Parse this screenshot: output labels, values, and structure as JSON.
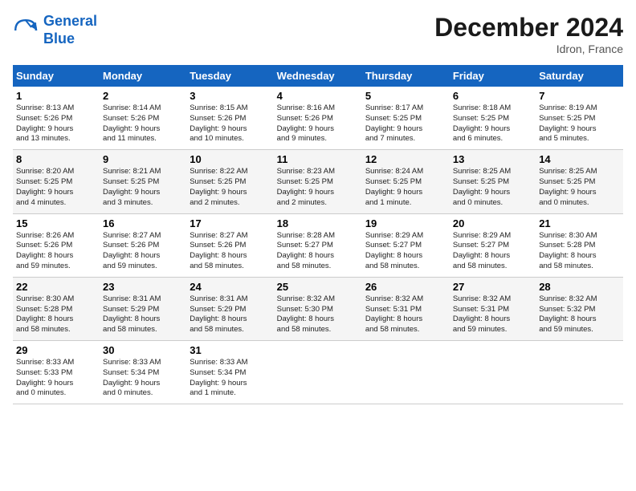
{
  "logo": {
    "line1": "General",
    "line2": "Blue"
  },
  "title": "December 2024",
  "location": "Idron, France",
  "days_of_week": [
    "Sunday",
    "Monday",
    "Tuesday",
    "Wednesday",
    "Thursday",
    "Friday",
    "Saturday"
  ],
  "weeks": [
    [
      {
        "day": "1",
        "info": "Sunrise: 8:13 AM\nSunset: 5:26 PM\nDaylight: 9 hours\nand 13 minutes."
      },
      {
        "day": "2",
        "info": "Sunrise: 8:14 AM\nSunset: 5:26 PM\nDaylight: 9 hours\nand 11 minutes."
      },
      {
        "day": "3",
        "info": "Sunrise: 8:15 AM\nSunset: 5:26 PM\nDaylight: 9 hours\nand 10 minutes."
      },
      {
        "day": "4",
        "info": "Sunrise: 8:16 AM\nSunset: 5:26 PM\nDaylight: 9 hours\nand 9 minutes."
      },
      {
        "day": "5",
        "info": "Sunrise: 8:17 AM\nSunset: 5:25 PM\nDaylight: 9 hours\nand 7 minutes."
      },
      {
        "day": "6",
        "info": "Sunrise: 8:18 AM\nSunset: 5:25 PM\nDaylight: 9 hours\nand 6 minutes."
      },
      {
        "day": "7",
        "info": "Sunrise: 8:19 AM\nSunset: 5:25 PM\nDaylight: 9 hours\nand 5 minutes."
      }
    ],
    [
      {
        "day": "8",
        "info": "Sunrise: 8:20 AM\nSunset: 5:25 PM\nDaylight: 9 hours\nand 4 minutes."
      },
      {
        "day": "9",
        "info": "Sunrise: 8:21 AM\nSunset: 5:25 PM\nDaylight: 9 hours\nand 3 minutes."
      },
      {
        "day": "10",
        "info": "Sunrise: 8:22 AM\nSunset: 5:25 PM\nDaylight: 9 hours\nand 2 minutes."
      },
      {
        "day": "11",
        "info": "Sunrise: 8:23 AM\nSunset: 5:25 PM\nDaylight: 9 hours\nand 2 minutes."
      },
      {
        "day": "12",
        "info": "Sunrise: 8:24 AM\nSunset: 5:25 PM\nDaylight: 9 hours\nand 1 minute."
      },
      {
        "day": "13",
        "info": "Sunrise: 8:25 AM\nSunset: 5:25 PM\nDaylight: 9 hours\nand 0 minutes."
      },
      {
        "day": "14",
        "info": "Sunrise: 8:25 AM\nSunset: 5:25 PM\nDaylight: 9 hours\nand 0 minutes."
      }
    ],
    [
      {
        "day": "15",
        "info": "Sunrise: 8:26 AM\nSunset: 5:26 PM\nDaylight: 8 hours\nand 59 minutes."
      },
      {
        "day": "16",
        "info": "Sunrise: 8:27 AM\nSunset: 5:26 PM\nDaylight: 8 hours\nand 59 minutes."
      },
      {
        "day": "17",
        "info": "Sunrise: 8:27 AM\nSunset: 5:26 PM\nDaylight: 8 hours\nand 58 minutes."
      },
      {
        "day": "18",
        "info": "Sunrise: 8:28 AM\nSunset: 5:27 PM\nDaylight: 8 hours\nand 58 minutes."
      },
      {
        "day": "19",
        "info": "Sunrise: 8:29 AM\nSunset: 5:27 PM\nDaylight: 8 hours\nand 58 minutes."
      },
      {
        "day": "20",
        "info": "Sunrise: 8:29 AM\nSunset: 5:27 PM\nDaylight: 8 hours\nand 58 minutes."
      },
      {
        "day": "21",
        "info": "Sunrise: 8:30 AM\nSunset: 5:28 PM\nDaylight: 8 hours\nand 58 minutes."
      }
    ],
    [
      {
        "day": "22",
        "info": "Sunrise: 8:30 AM\nSunset: 5:28 PM\nDaylight: 8 hours\nand 58 minutes."
      },
      {
        "day": "23",
        "info": "Sunrise: 8:31 AM\nSunset: 5:29 PM\nDaylight: 8 hours\nand 58 minutes."
      },
      {
        "day": "24",
        "info": "Sunrise: 8:31 AM\nSunset: 5:29 PM\nDaylight: 8 hours\nand 58 minutes."
      },
      {
        "day": "25",
        "info": "Sunrise: 8:32 AM\nSunset: 5:30 PM\nDaylight: 8 hours\nand 58 minutes."
      },
      {
        "day": "26",
        "info": "Sunrise: 8:32 AM\nSunset: 5:31 PM\nDaylight: 8 hours\nand 58 minutes."
      },
      {
        "day": "27",
        "info": "Sunrise: 8:32 AM\nSunset: 5:31 PM\nDaylight: 8 hours\nand 59 minutes."
      },
      {
        "day": "28",
        "info": "Sunrise: 8:32 AM\nSunset: 5:32 PM\nDaylight: 8 hours\nand 59 minutes."
      }
    ],
    [
      {
        "day": "29",
        "info": "Sunrise: 8:33 AM\nSunset: 5:33 PM\nDaylight: 9 hours\nand 0 minutes."
      },
      {
        "day": "30",
        "info": "Sunrise: 8:33 AM\nSunset: 5:34 PM\nDaylight: 9 hours\nand 0 minutes."
      },
      {
        "day": "31",
        "info": "Sunrise: 8:33 AM\nSunset: 5:34 PM\nDaylight: 9 hours\nand 1 minute."
      },
      {
        "day": "",
        "info": ""
      },
      {
        "day": "",
        "info": ""
      },
      {
        "day": "",
        "info": ""
      },
      {
        "day": "",
        "info": ""
      }
    ]
  ]
}
